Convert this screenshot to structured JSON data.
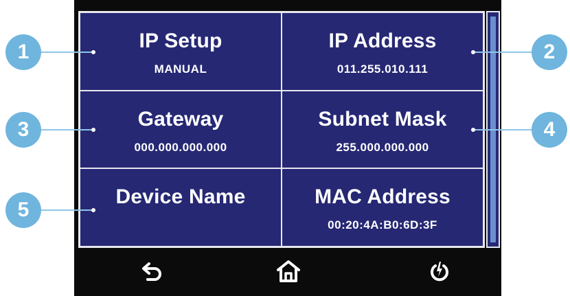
{
  "settings": {
    "cells": [
      {
        "title": "IP Setup",
        "value": "MANUAL"
      },
      {
        "title": "IP Address",
        "value": "011.255.010.111"
      },
      {
        "title": "Gateway",
        "value": "000.000.000.000"
      },
      {
        "title": "Subnet Mask",
        "value": "255.000.000.000"
      },
      {
        "title": "Device Name",
        "value": ""
      },
      {
        "title": "MAC Address",
        "value": "00:20:4A:B0:6D:3F"
      }
    ]
  },
  "callouts": [
    "1",
    "2",
    "3",
    "4",
    "5"
  ],
  "nav": {
    "icons": [
      "back-arrow-icon",
      "home-icon",
      "power-icon"
    ]
  },
  "colors": {
    "panel": "#262874",
    "border": "#e8e8f0",
    "callout": "#6fb5dd",
    "scroll_thumb": "#6b8fcf",
    "bezel": "#0b0b0b"
  }
}
